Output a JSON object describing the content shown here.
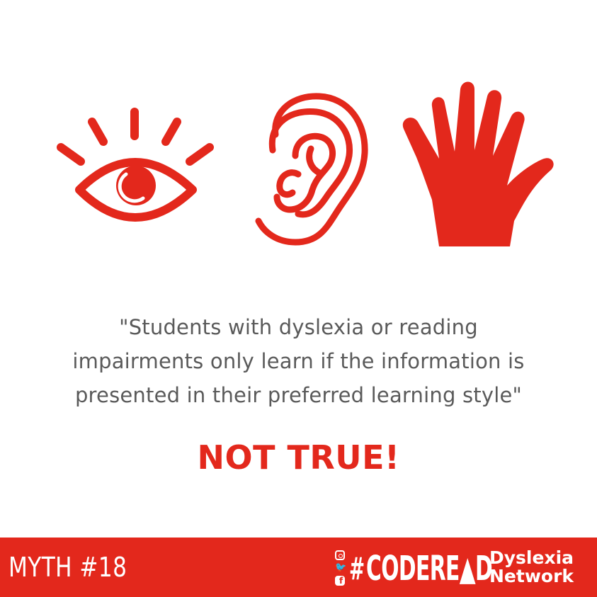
{
  "quote": {
    "line1": "\"Students with dyslexia or reading",
    "line2": "impairments only learn if the information is",
    "line3": "presented in their preferred learning style\""
  },
  "verdict": "NOT TRUE!",
  "footer": {
    "myth_label": "MYTH #18",
    "hashtag": "#",
    "brand_name": "CODERE▲D",
    "network_line1": "Dyslexia",
    "network_line2": "Network"
  },
  "icons": [
    "eye-icon",
    "ear-icon",
    "hand-icon",
    "instagram-icon",
    "twitter-icon",
    "facebook-icon"
  ],
  "colors": {
    "accent": "#e3281c",
    "text": "#5a5a5a",
    "background": "#ffffff"
  }
}
